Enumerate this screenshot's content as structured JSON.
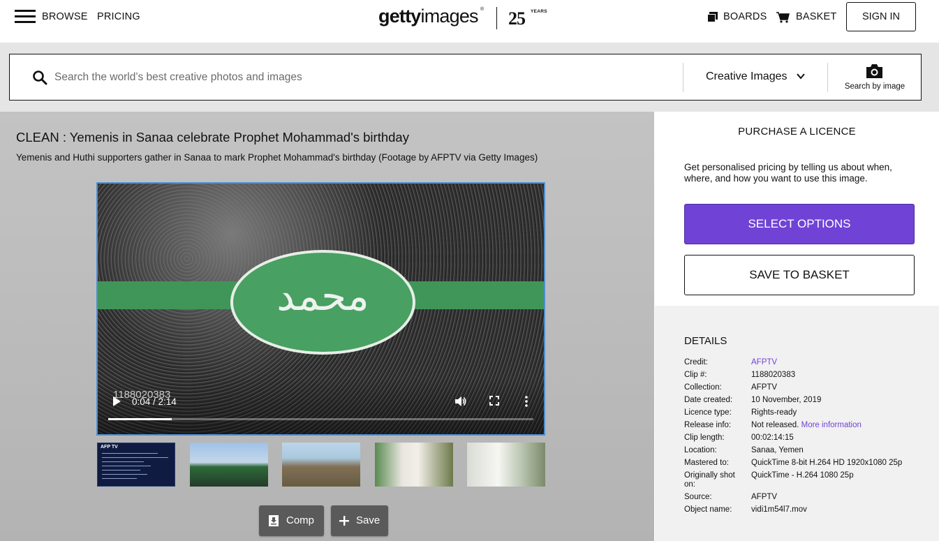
{
  "header": {
    "menu_label": "BROWSE",
    "pricing_label": "PRICING",
    "logo": {
      "brand_bold": "getty",
      "brand_thin": "images",
      "registered": "®",
      "anniversary": "25",
      "anniversary_sub": "YEARS"
    },
    "boards_label": "BOARDS",
    "basket_label": "BASKET",
    "signin_label": "SIGN IN",
    "icons": [
      "hamburger-icon",
      "boards-icon",
      "basket-icon"
    ]
  },
  "search": {
    "placeholder": "Search the world’s best creative photos and images",
    "value": "",
    "filter_selected": "Creative Images",
    "search_by_image_label": "Search by image",
    "icons": [
      "search-icon",
      "chevron-down-icon",
      "camera-icon"
    ]
  },
  "media": {
    "title": "CLEAN : Yemenis in Sanaa celebrate Prophet Mohammad's birthday",
    "caption": "Yemenis and Huthi supporters gather in Sanaa to mark Prophet Mohammad's birthday (Footage by AFPTV via Getty Images)",
    "player": {
      "clip_watermark": "1188020383",
      "timecode": "0:04 / 2:14",
      "progress_fraction": 0.15,
      "icons": [
        "play-icon",
        "volume-icon",
        "fullscreen-icon",
        "more-options-icon"
      ]
    },
    "thumbnails": [
      {
        "name": "thumbnail-1",
        "badge": "AFP TV"
      },
      {
        "name": "thumbnail-2"
      },
      {
        "name": "thumbnail-3"
      },
      {
        "name": "thumbnail-4"
      },
      {
        "name": "thumbnail-5"
      }
    ],
    "comp_label": "Comp",
    "save_label": "Save"
  },
  "purchase": {
    "heading": "PURCHASE A LICENCE",
    "description": "Get personalised pricing by telling us about when, where, and how you want to use this image.",
    "select_options_label": "SELECT OPTIONS",
    "save_to_basket_label": "SAVE TO BASKET",
    "accent_color": "#7043d6"
  },
  "details": {
    "heading": "DETAILS",
    "rows": [
      {
        "key": "Credit:",
        "value": "AFPTV",
        "link": true
      },
      {
        "key": "Clip #:",
        "value": "1188020383"
      },
      {
        "key": "Collection:",
        "value": "AFPTV"
      },
      {
        "key": "Date created:",
        "value": "10 November, 2019"
      },
      {
        "key": "Licence type:",
        "value": "Rights-ready"
      },
      {
        "key": "Release info:",
        "value": "Not released.",
        "extra_link": "More information"
      },
      {
        "key": "Clip length:",
        "value": "00:02:14:15"
      },
      {
        "key": "Location:",
        "value": "Sanaa, Yemen"
      },
      {
        "key": "Mastered to:",
        "value": "QuickTime 8-bit H.264 HD 1920x1080 25p"
      },
      {
        "key": "Originally shot on:",
        "value": "QuickTime - H.264 1080 25p"
      },
      {
        "key": "Source:",
        "value": "AFPTV"
      },
      {
        "key": "Object name:",
        "value": "vidi1m54l7.mov"
      }
    ]
  }
}
